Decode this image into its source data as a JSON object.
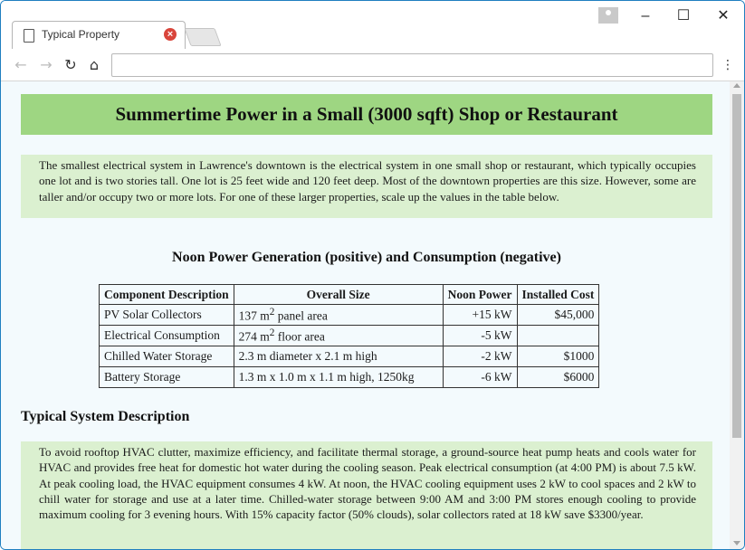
{
  "browser": {
    "tab_title": "Typical Property",
    "tab_close_glyph": "×",
    "minimize_glyph": "–",
    "maximize_glyph": "☐",
    "close_glyph": "✕",
    "back_glyph": "←",
    "forward_glyph": "→",
    "reload_glyph": "↻",
    "home_glyph": "⌂",
    "menu_glyph": "⋮",
    "address_value": ""
  },
  "page": {
    "title": "Summertime Power in a Small (3000 sqft) Shop or Restaurant",
    "intro": "The smallest electrical system in Lawrence's downtown is the electrical system in one small shop or restaurant, which typically occupies one lot and is two stories tall. One lot is 25 feet wide and 120 feet deep. Most of the downtown properties are this size. However, some are taller and/or occupy two or more lots. For one of these larger properties, scale up the values in the table below.",
    "table_heading": "Noon Power Generation (positive) and Consumption (negative)",
    "table": {
      "headers": [
        "Component Description",
        "Overall Size",
        "Noon Power",
        "Installed Cost"
      ],
      "rows": [
        {
          "component": "PV Solar Collectors",
          "size": "137 m",
          "size_sup": "2",
          "size_suffix": " panel area",
          "power": "+15 kW",
          "cost": "$45,000"
        },
        {
          "component": "Electrical Consumption",
          "size": "274 m",
          "size_sup": "2",
          "size_suffix": " floor area",
          "power": "-5 kW",
          "cost": ""
        },
        {
          "component": "Chilled Water Storage",
          "size": "2.3 m diameter x 2.1 m high",
          "size_sup": "",
          "size_suffix": "",
          "power": "-2 kW",
          "cost": "$1000"
        },
        {
          "component": "Battery Storage",
          "size": "1.3 m x 1.0 m x 1.1 m high, 1250kg",
          "size_sup": "",
          "size_suffix": "",
          "power": "-6 kW",
          "cost": "$6000"
        }
      ]
    },
    "section_heading": "Typical System Description",
    "description": "To avoid rooftop HVAC clutter, maximize efficiency, and facilitate thermal storage, a ground-source heat pump heats and cools water for HVAC and provides free heat for domestic hot water during the cooling season. Peak electrical consumption (at 4:00 PM) is about 7.5 kW. At peak cooling load, the HVAC equipment consumes 4 kW. At noon, the HVAC cooling equipment uses 2 kW to cool spaces and 2 kW to chill water for storage and use at a later time. Chilled-water storage between 9:00 AM and 3:00 PM stores enough cooling to provide maximum cooling for 3 evening hours. With 15% capacity factor (50% clouds), solar collectors rated at 18 kW save $3300/year."
  },
  "colors": {
    "title_band": "#9ed682",
    "text_band": "#dbf0d0",
    "page_background": "#f3fafd",
    "window_border": "#1f7fc0",
    "tab_close": "#d9453b"
  },
  "icons": {
    "tab": "page-icon",
    "tab_close": "close-circle-icon",
    "profile": "user-icon",
    "back": "arrow-left-icon",
    "forward": "arrow-right-icon",
    "reload": "reload-icon",
    "home": "home-icon",
    "menu": "kebab-menu-icon"
  }
}
